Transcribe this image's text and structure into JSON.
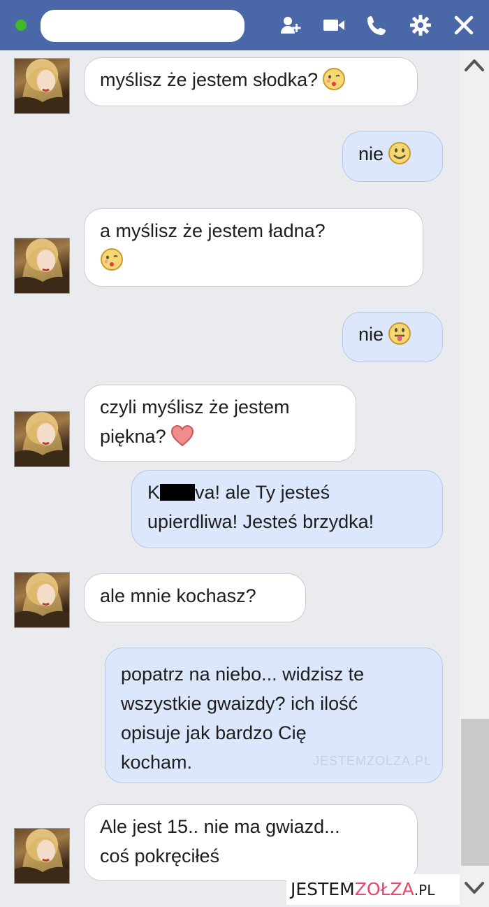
{
  "watermark": {
    "inline": "JESTEMZOLZA.PL"
  },
  "logo": {
    "part1": "JESTEM",
    "part2": "ZOŁZA",
    "part3": ".PL"
  },
  "colors": {
    "header": "#4a67a8",
    "incoming_bubble": "#ffffff",
    "outgoing_bubble": "#dce7fb",
    "online": "#42b72a",
    "accent": "#e6496d"
  },
  "messages": [
    {
      "from": "her",
      "line1": "myślisz że jestem słodka?",
      "emoji": "kiss-face"
    },
    {
      "from": "me",
      "line1": "nie",
      "emoji": "smile-face"
    },
    {
      "from": "her",
      "line1": "a myślisz że jestem ładna?",
      "emoji": "kiss-face"
    },
    {
      "from": "me",
      "line1": "nie",
      "emoji": "tongue-face"
    },
    {
      "from": "her",
      "line1": "czyli myślisz że jestem",
      "line2": "piękna?",
      "emoji": "heart"
    },
    {
      "from": "me",
      "line1_a": "K",
      "line1_b": "va! ale Ty jesteś",
      "line2": "upierdliwa! Jesteś brzydka!"
    },
    {
      "from": "her",
      "line1": "ale mnie kochasz?"
    },
    {
      "from": "me",
      "line1": "popatrz na niebo... widzisz te",
      "line2": "wszystkie gwaizdy? ich ilość",
      "line3": "opisuje jak bardzo Cię",
      "line4": "kocham."
    },
    {
      "from": "her",
      "line1": "Ale jest 15.. nie ma gwiazd...",
      "line2": "coś pokręciłeś"
    }
  ]
}
